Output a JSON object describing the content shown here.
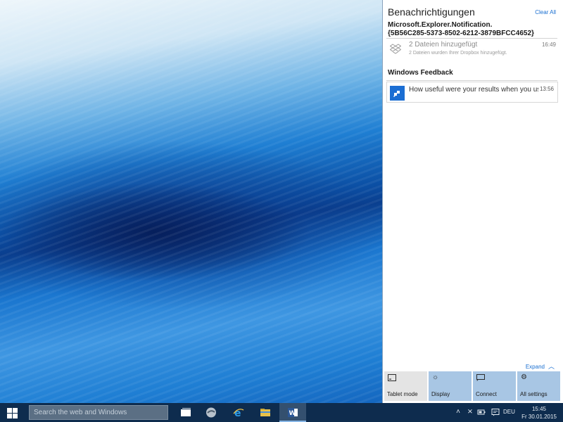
{
  "action_center": {
    "header": "Benachrichtigungen",
    "clear_all": "Clear All",
    "groups": [
      {
        "app": "Microsoft.Explorer.Notification.\n{5B56C285-5373-8502-6212-3879BFCC4652}",
        "items": [
          {
            "icon": "dropbox-icon",
            "title": "2 Dateien hinzugefügt",
            "body": "2 Dateien wurden Ihrer Dropbox hinzugefügt.",
            "time": "16:49"
          }
        ]
      },
      {
        "app": "Windows Feedback",
        "items": [
          {
            "icon": "feedback-icon",
            "title": "How useful were your results when you us",
            "time": "13:56"
          }
        ]
      }
    ],
    "expand_label": "Expand",
    "quick_actions": [
      {
        "label": "Tablet mode",
        "icon": "tablet-icon",
        "state": "off"
      },
      {
        "label": "Display",
        "icon": "sun-icon",
        "state": "on"
      },
      {
        "label": "Connect",
        "icon": "connect-icon",
        "state": "on"
      },
      {
        "label": "All settings",
        "icon": "gear-icon",
        "state": "on"
      }
    ]
  },
  "taskbar": {
    "search_placeholder": "Search the web and Windows",
    "pinned": [
      "task-view",
      "app-icon",
      "internet-explorer",
      "file-explorer",
      "word"
    ],
    "tray": {
      "language": "DEU",
      "time": "15:45",
      "date": "Fr 30.01.2015"
    }
  },
  "colors": {
    "accent": "#1a6fd1",
    "taskbar": "#0e2c4e",
    "tile_on": "#a8c6e4",
    "tile_off": "#e4e4e4"
  }
}
